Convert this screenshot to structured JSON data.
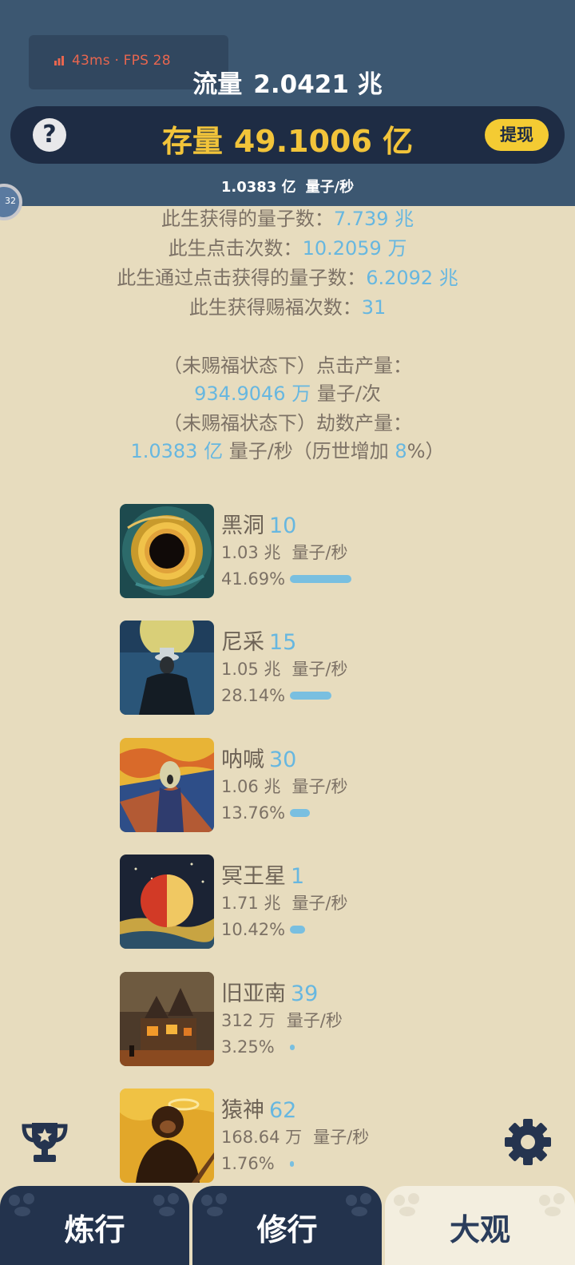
{
  "perf": {
    "text": "43ms · FPS 28"
  },
  "header": {
    "flow_label": "流量",
    "flow_value": "2.0421 兆",
    "stock_label": "存量",
    "stock_value": "49.1006 亿",
    "help_label": "?",
    "withdraw_label": "提现",
    "rate_value": "1.0383 亿",
    "rate_unit": "量子/秒",
    "side_badge_text": "32"
  },
  "stats": {
    "lifetime_quanta_label": "此生获得的量子数：",
    "lifetime_quanta_value": "7.739 兆",
    "clicks_label": "此生点击次数：",
    "clicks_value": "10.2059 万",
    "click_quanta_label": "此生通过点击获得的量子数：",
    "click_quanta_value": "6.2092 兆",
    "blessing_label": "此生获得赐福次数：",
    "blessing_value": "31",
    "click_output_label": "（未赐福状态下）点击产量：",
    "click_output_value": "934.9046 万",
    "click_output_unit": " 量子/次",
    "kalpa_output_label": "（未赐福状态下）劫数产量：",
    "kalpa_output_value": "1.0383 亿",
    "kalpa_output_unit": " 量子/秒（历世增加 ",
    "kalpa_bonus_value": "8",
    "kalpa_bonus_suffix": "%）"
  },
  "items": [
    {
      "name": "黑洞",
      "level": "10",
      "rate": "1.03 兆",
      "unit": "量子/秒",
      "percent": "41.69%",
      "share": 41.69
    },
    {
      "name": "尼采",
      "level": "15",
      "rate": "1.05 兆",
      "unit": "量子/秒",
      "percent": "28.14%",
      "share": 28.14
    },
    {
      "name": "呐喊",
      "level": "30",
      "rate": "1.06 兆",
      "unit": "量子/秒",
      "percent": "13.76%",
      "share": 13.76
    },
    {
      "name": "冥王星",
      "level": "1",
      "rate": "1.71 兆",
      "unit": "量子/秒",
      "percent": "10.42%",
      "share": 10.42
    },
    {
      "name": "旧亚南",
      "level": "39",
      "rate": "312 万",
      "unit": "量子/秒",
      "percent": "3.25%",
      "share": 3.25
    },
    {
      "name": "猿神",
      "level": "62",
      "rate": "168.64 万",
      "unit": "量子/秒",
      "percent": "1.76%",
      "share": 1.76
    }
  ],
  "tabs": [
    {
      "label": "炼行",
      "active": false
    },
    {
      "label": "修行",
      "active": false
    },
    {
      "label": "大观",
      "active": true
    }
  ],
  "icons": {
    "trophy": "trophy-icon",
    "gear": "gear-icon",
    "help": "help-icon",
    "signal": "signal-icon"
  },
  "colors": {
    "header_bg": "#3c5771",
    "page_bg": "#e7dcbe",
    "accent_yellow": "#f2c43a",
    "accent_blue": "#67b7e0",
    "tab_dark": "#23334d"
  }
}
